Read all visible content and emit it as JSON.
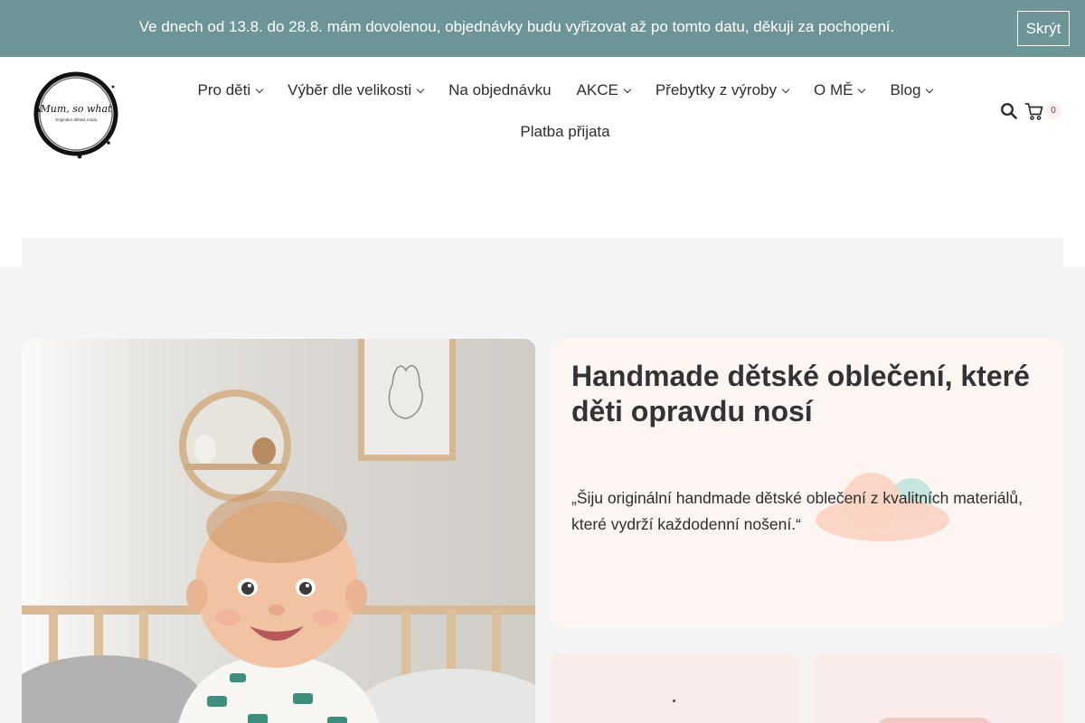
{
  "notice": {
    "text": "Ve dnech od 13.8. do 28.8. mám dovolenou, objednávky budu vyřizovat až po tomto datu, děkuji za pochopení.",
    "dismiss_label": "Skrýt"
  },
  "header": {
    "logo": {
      "title": "Mum, so what",
      "tagline": "Originální dětská móda"
    },
    "nav": {
      "items": [
        {
          "label": "Pro děti",
          "has_dropdown": true
        },
        {
          "label": "Výběr dle velikosti",
          "has_dropdown": true
        },
        {
          "label": "Na objednávku",
          "has_dropdown": false
        },
        {
          "label": "AKCE",
          "has_dropdown": true
        },
        {
          "label": "Přebytky z výroby",
          "has_dropdown": true
        },
        {
          "label": "O MĚ",
          "has_dropdown": true
        },
        {
          "label": "Blog",
          "has_dropdown": true
        },
        {
          "label": "Platba přijata",
          "has_dropdown": false
        }
      ]
    },
    "icons": {
      "search": "search-icon",
      "cart": "cart-icon"
    },
    "cart_count": "0"
  },
  "hero": {
    "title": "Handmade dětské oblečení, které děti opravdu nosí",
    "quote": "„Šiju originální handmade dětské oblečení z kvalitních materiálů, které vydrží každodenní nošení.“"
  },
  "colors": {
    "notice_bg": "#6d9598",
    "page_bg": "#f4f4f4",
    "hero_card_bg": "#fdf5f2",
    "tile_bg": "#fbecec",
    "cloud_peach": "#fbd3c1",
    "cloud_mint": "#bde3dc"
  }
}
